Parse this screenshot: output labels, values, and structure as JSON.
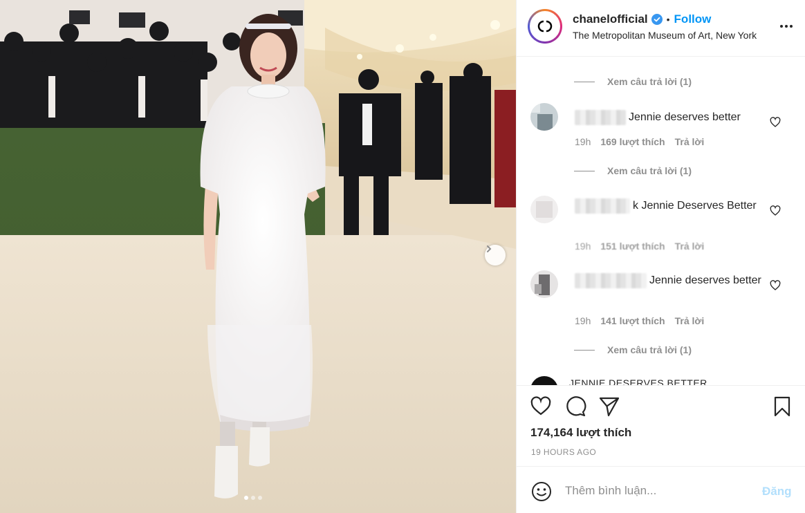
{
  "post": {
    "image_alt": "Woman in a white lace dress on a red carpet",
    "carousel_dots": [
      true,
      false,
      false
    ]
  },
  "header": {
    "username": "chanelofficial",
    "separator": "•",
    "follow_label": "Follow",
    "location": "The Metropolitan Museum of Art, New York"
  },
  "comments": [
    {
      "view_replies": "Xem câu trả lời (1)"
    },
    {
      "text": "Jennie deserves better",
      "time": "19h",
      "likes": "169 lượt thích",
      "reply": "Trả lời",
      "view_replies": "Xem câu trả lời (1)"
    },
    {
      "text_prefix": "k",
      "text": "Jennie Deserves Better",
      "time": "19h",
      "likes": "151 lượt thích",
      "reply": "Trả lời"
    },
    {
      "text": "Jennie deserves better",
      "time": "19h",
      "likes": "141 lượt thích",
      "reply": "Trả lời",
      "view_replies": "Xem câu trả lời (1)"
    }
  ],
  "peek_comment": "JENNIE DESERVES BETTER",
  "actions": {
    "likes_count": "174,164 lượt thích",
    "time_ago": "19 HOURS AGO"
  },
  "add_comment": {
    "placeholder": "Thêm bình luận...",
    "post_label": "Đăng"
  },
  "colors": {
    "link_blue": "#0095f6",
    "post_disabled": "#b2dffc",
    "meta_gray": "#8e8e8e"
  }
}
